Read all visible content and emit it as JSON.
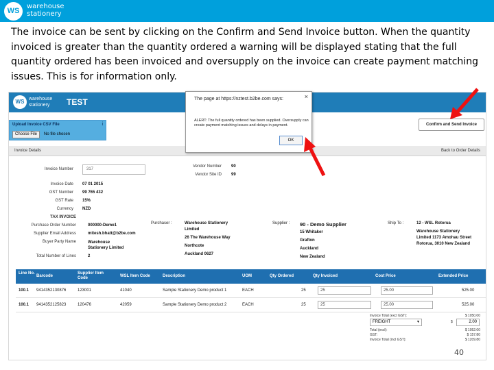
{
  "slide": {
    "brand_line1": "warehouse",
    "brand_line2": "stationery",
    "logo_text": "WS",
    "paragraph": "The invoice can be sent by clicking on the Confirm and Send Invoice button. When the quantity invoiced is greater than the quantity ordered a warning will be displayed stating that the full quantity ordered has been invoiced and oversupply on the invoice can create payment matching issues.  This is for information only.",
    "page_number": "40",
    "arrow_color": "#ee1111"
  },
  "app": {
    "logo_text": "WS",
    "brand_line1": "warehouse",
    "brand_line2": "stationery",
    "environment": "TEST",
    "header_color": "#1f7db8"
  },
  "upload": {
    "title": "Upload Invoice CSV File",
    "info_icon": "i",
    "choose_button": "Choose File",
    "no_file": "No file chosen"
  },
  "actions": {
    "confirm_send": "Confirm and Send Invoice"
  },
  "details": {
    "title": "Invoice Details",
    "back_link": "Back to Order Details",
    "invoice_number_label": "Invoice Number",
    "invoice_number_value": "317",
    "fields": [
      {
        "label": "Invoice Date",
        "value": "07 01 2015"
      },
      {
        "label": "GST Number",
        "value": "99 765 432"
      },
      {
        "label": "GST Rate",
        "value": "15%"
      },
      {
        "label": "Currency",
        "value": "NZD"
      },
      {
        "label": "TAX INVOICE",
        "value": ""
      },
      {
        "label": "Purchase Order Number",
        "value": "000000-Demo1"
      },
      {
        "label": "Supplier Email Address",
        "value": "mitesh.bhatt@b2be.com"
      },
      {
        "label": "Buyer Party Name",
        "value": "Warehouse Stationery Limited"
      },
      {
        "label": "Total Number of Lines",
        "value": "2"
      }
    ],
    "vendor_number_label": "Vendor Number",
    "vendor_number_value": "90",
    "vendor_site_label": "Vendor Site ID",
    "vendor_site_value": "99",
    "purchaser_label": "Purchaser :",
    "purchaser_lines": [
      "Warehouse Stationery",
      "Limited",
      "26 The Warehouse Way",
      "Northcote",
      "Auckland 0627"
    ],
    "supplier_label": "Supplier :",
    "supplier_name": "90 - Demo Supplier",
    "supplier_lines": [
      "15 Whitaker",
      "Grafton",
      "Auckland",
      "New Zealand"
    ],
    "shipto_label": "Ship To :",
    "shipto_name": "12 - WSL Rotorua",
    "shipto_lines": [
      "Warehouse Stationery",
      "Limited 1173 Amohau Street",
      "Rotorua, 3010 New Zealand"
    ]
  },
  "table": {
    "headers": [
      "Line No.",
      "Barcode",
      "Supplier Item Code",
      "WSL Item Code",
      "Description",
      "UOM",
      "Qty Ordered",
      "Qty Invoiced",
      "Cost Price",
      "Extended Price"
    ],
    "rows": [
      {
        "line": "100.1",
        "barcode": "9414352130876",
        "supplier_code": "123001",
        "wsl_code": "41040",
        "description": "Sample Stationery Demo product 1",
        "uom": "EACH",
        "qty_ordered": "25",
        "qty_invoiced": "25",
        "cost": "25.00",
        "extended": "525.00"
      },
      {
        "line": "100.1",
        "barcode": "9414352125823",
        "supplier_code": "120476",
        "wsl_code": "42059",
        "description": "Sample Stationery Demo product 2",
        "uom": "EACH",
        "qty_ordered": "25",
        "qty_invoiced": "25",
        "cost": "25.00",
        "extended": "525.00"
      }
    ]
  },
  "totals": {
    "excl_label": "Invoice Total (excl GST):",
    "excl_value": "$ 1050.00",
    "freight_option": "FREIGHT",
    "freight_currency": "$",
    "freight_value": "2.00",
    "total_label": "Total (excl):",
    "total_value": "$ 1052.00",
    "gst_label": "GST:",
    "gst_value": "$ 157.80",
    "incl_label": "Invoice Total (incl GST):",
    "incl_value": "$ 1209.80"
  },
  "dialog": {
    "title": "The page at https://nztest.b2be.com says:",
    "close": "×",
    "message": "ALERT: The full quantity ordered has been supplied. Oversupply can create payment matching issues and delays in payment.",
    "ok": "OK"
  }
}
